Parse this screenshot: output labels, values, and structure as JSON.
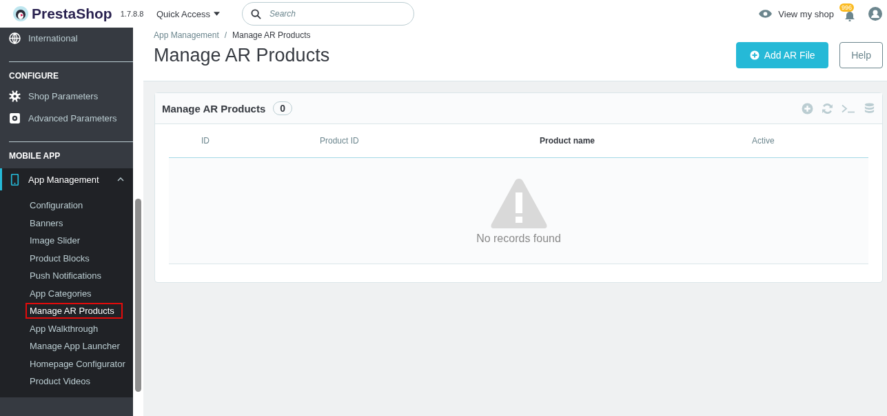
{
  "header": {
    "logo": "PrestaShop",
    "version": "1.7.8.8",
    "quick_access": "Quick Access",
    "search": {
      "placeholder": "Search"
    },
    "view_shop": "View my shop",
    "notifications": "996"
  },
  "sidebar": {
    "top_item": "International",
    "sections": [
      {
        "title": "CONFIGURE",
        "items": [
          {
            "label": "Shop Parameters"
          },
          {
            "label": "Advanced Parameters"
          }
        ]
      },
      {
        "title": "MOBILE APP",
        "items": [
          {
            "label": "App Management",
            "expanded": true,
            "children": [
              {
                "label": "Configuration",
                "selected": false
              },
              {
                "label": "Banners",
                "selected": false
              },
              {
                "label": "Image Slider",
                "selected": false
              },
              {
                "label": "Product Blocks",
                "selected": false
              },
              {
                "label": "Push Notifications",
                "selected": false
              },
              {
                "label": "App Categories",
                "selected": false
              },
              {
                "label": "Manage AR Products",
                "selected": true
              },
              {
                "label": "App Walkthrough",
                "selected": false
              },
              {
                "label": "Manage App Launcher",
                "selected": false
              },
              {
                "label": "Homepage Configurator",
                "selected": false
              },
              {
                "label": "Product Videos",
                "selected": false
              }
            ]
          }
        ]
      }
    ]
  },
  "breadcrumb": [
    "App Management",
    "Manage AR Products"
  ],
  "breadcrumb_separator": "/",
  "page_title": "Manage AR Products",
  "toolbar_buttons": [
    {
      "label": "Add AR File",
      "kind": "primary"
    },
    {
      "label": "Help",
      "kind": "outline"
    }
  ],
  "panel": {
    "title": "Manage AR Products",
    "count": "0",
    "columns": [
      {
        "label": "ID",
        "sorted": false
      },
      {
        "label": "Product ID",
        "sorted": false
      },
      {
        "label": "Product name",
        "sorted": true
      },
      {
        "label": "Active",
        "sorted": false
      }
    ],
    "empty_message": "No records found"
  }
}
